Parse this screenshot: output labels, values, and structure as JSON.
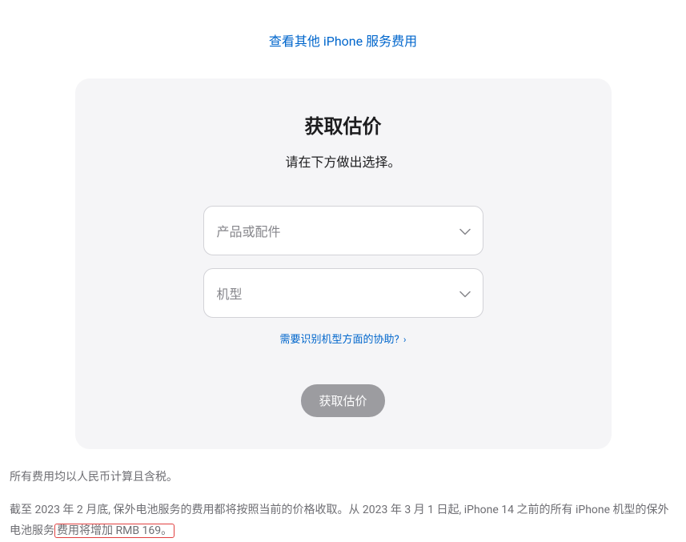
{
  "topLink": {
    "text": "查看其他 iPhone 服务费用"
  },
  "card": {
    "title": "获取估价",
    "subtitle": "请在下方做出选择。",
    "select1": {
      "placeholder": "产品或配件"
    },
    "select2": {
      "placeholder": "机型"
    },
    "helpLink": {
      "text": "需要识别机型方面的协助?",
      "arrow": "›"
    },
    "submitButton": {
      "label": "获取估价"
    }
  },
  "footer": {
    "line1": "所有费用均以人民币计算且含税。",
    "line2_part1": "截至 2023 年 2 月底, 保外电池服务的费用都将按照当前的价格收取。从 2023 年 3 月 1 日起, iPhone 14 之前的所有 iPhone 机型的保外电池服务",
    "line2_highlight": "费用将增加 RMB 169。"
  }
}
